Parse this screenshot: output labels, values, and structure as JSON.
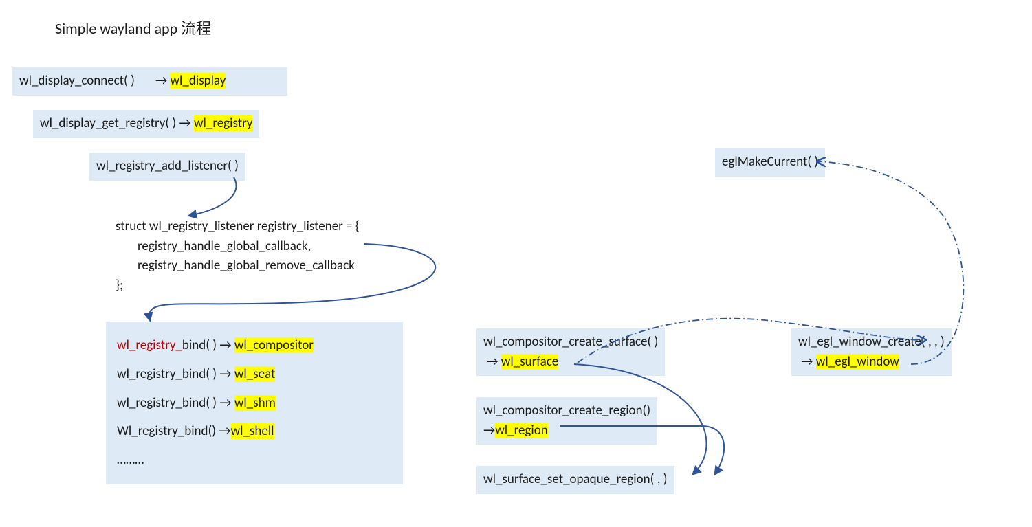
{
  "title": "Simple wayland app 流程",
  "n1": {
    "call": "wl_display_connect( )",
    "arrow": "→",
    "ret": "wl_display"
  },
  "n2": {
    "call": "wl_display_get_registry( )",
    "arrow": "→",
    "ret": "wl_registry"
  },
  "n3": {
    "call": "wl_registry_add_listener(   )"
  },
  "struct": {
    "l1": "struct wl_registry_listener registry_listener = {",
    "l2": "registry_handle_global_callback,",
    "l3": "registry_handle_global_remove_callback",
    "l4": "};"
  },
  "binds": {
    "b1_pre": "wl_registry_",
    "b1_call": "bind( ) →",
    "b1_ret": "wl_compositor",
    "b2": "wl_registry_bind( ) →",
    "b2_ret": "wl_seat",
    "b3": "wl_registry_bind( ) →",
    "b3_ret": "wl_shm",
    "b4": "Wl_registry_bind()  →",
    "b4_ret": "wl_shell",
    "more": "………"
  },
  "surf": {
    "call": "wl_compositor_create_surface( )",
    "arrow": "→",
    "ret": "wl_surface"
  },
  "region": {
    "call": "wl_compositor_create_region()",
    "arrow": "→",
    "ret": "wl_region"
  },
  "setopaque": {
    "call": "wl_surface_set_opaque_region(     ,     )"
  },
  "eglwin": {
    "call": "wl_egl_window_create(   ,  ,  )",
    "arrow": "→",
    "ret": "wl_egl_window"
  },
  "eglmake": {
    "call": "eglMakeCurrent(    )"
  },
  "colors": {
    "box_bg": "#deebf7",
    "highlight": "#ffff00",
    "accent_red": "#c00000",
    "arrow": "#2f5597"
  }
}
